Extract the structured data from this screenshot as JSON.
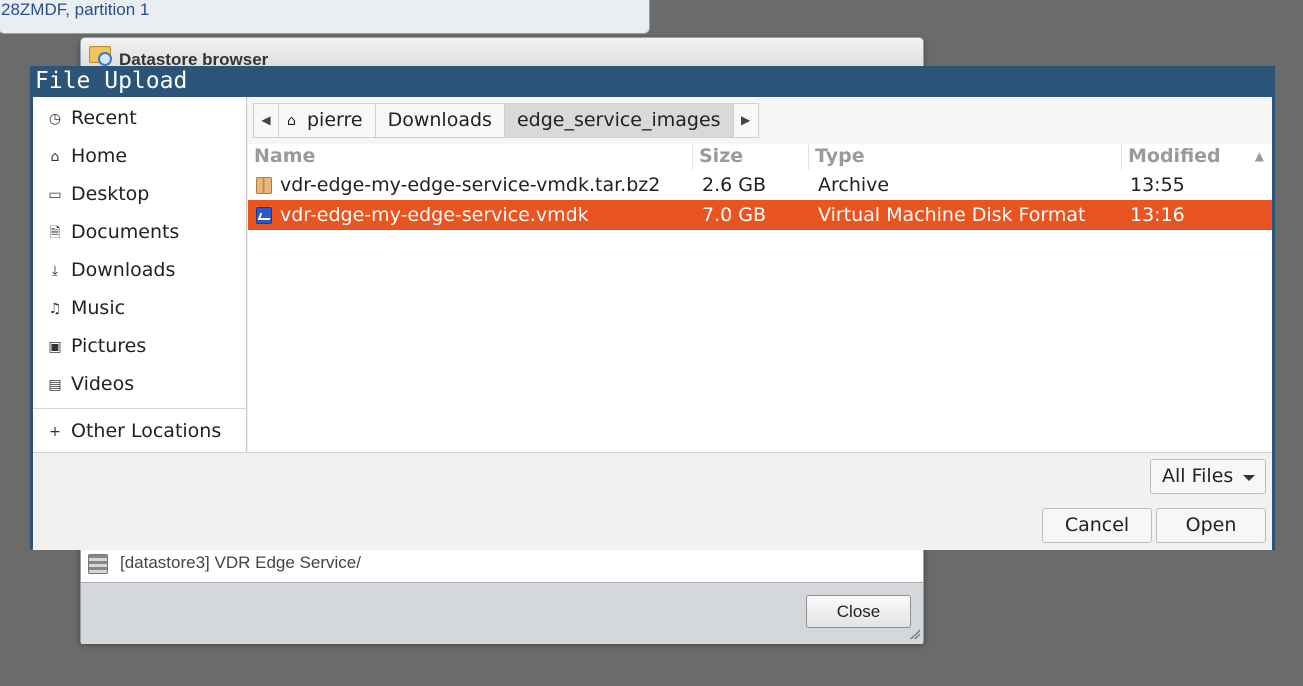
{
  "background": {
    "top_panel_text": "28ZMDF, partition 1"
  },
  "datastore_browser": {
    "title": "Datastore browser",
    "row_label": "[datastore3] VDR Edge Service/",
    "close_label": "Close"
  },
  "file_upload": {
    "title": "File Upload",
    "sidebar": {
      "items": [
        {
          "label": "Recent",
          "icon": "clock-icon"
        },
        {
          "label": "Home",
          "icon": "home-icon"
        },
        {
          "label": "Desktop",
          "icon": "desktop-icon"
        },
        {
          "label": "Documents",
          "icon": "document-icon"
        },
        {
          "label": "Downloads",
          "icon": "download-icon"
        },
        {
          "label": "Music",
          "icon": "music-icon"
        },
        {
          "label": "Pictures",
          "icon": "picture-icon"
        },
        {
          "label": "Videos",
          "icon": "video-icon"
        }
      ],
      "other_locations": "Other Locations"
    },
    "pathbar": {
      "segments": [
        "pierre",
        "Downloads",
        "edge_service_images"
      ]
    },
    "columns": {
      "name": "Name",
      "size": "Size",
      "type": "Type",
      "modified": "Modified"
    },
    "files": [
      {
        "name": "vdr-edge-my-edge-service-vmdk.tar.bz2",
        "size": "2.6 GB",
        "type": "Archive",
        "modified": "13:55",
        "icon": "archive-icon",
        "selected": false
      },
      {
        "name": "vdr-edge-my-edge-service.vmdk",
        "size": "7.0 GB",
        "type": "Virtual Machine Disk Format",
        "modified": "13:16",
        "icon": "disk-image-icon",
        "selected": true
      }
    ],
    "filter_label": "All Files",
    "cancel_label": "Cancel",
    "open_label": "Open",
    "selection_color": "#e95420",
    "title_bar_color": "#2b5578"
  }
}
